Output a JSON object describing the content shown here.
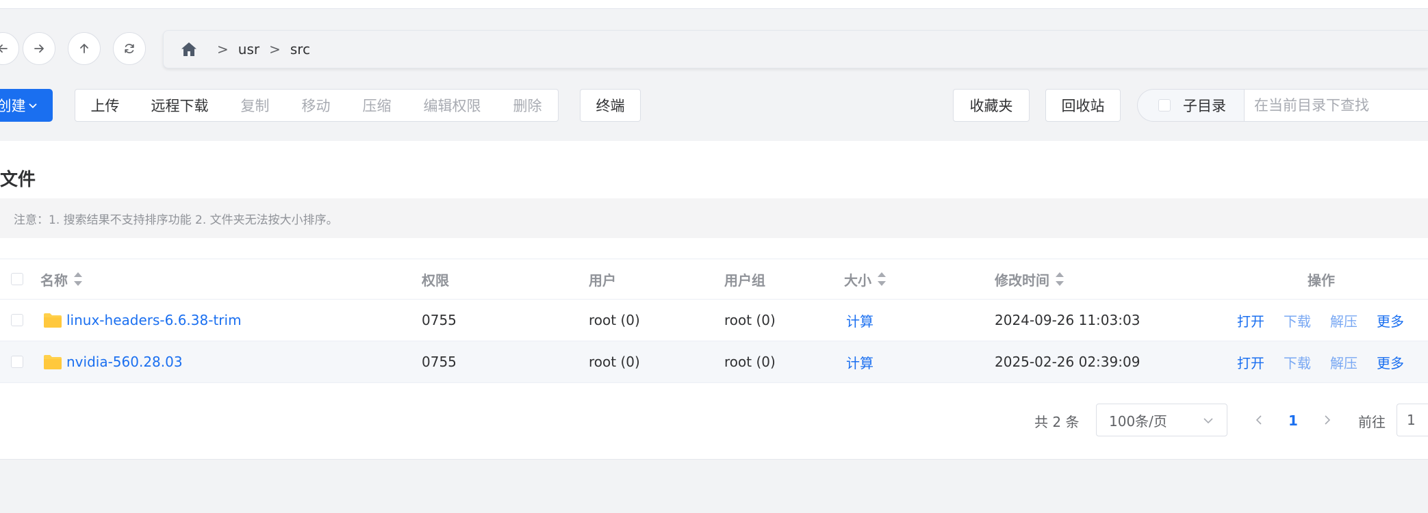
{
  "nav": {
    "back_icon": "arrow-left-icon",
    "forward_icon": "arrow-right-icon",
    "up_icon": "arrow-up-icon",
    "refresh_icon": "refresh-icon"
  },
  "breadcrumb": {
    "home_icon": "home-icon",
    "separator": ">",
    "parts": [
      "usr",
      "src"
    ]
  },
  "toolbar": {
    "new_label": "创建",
    "upload": "上传",
    "remote_download": "远程下载",
    "copy": "复制",
    "move": "移动",
    "compress": "压缩",
    "edit_permissions": "编辑权限",
    "delete": "删除",
    "terminal": "终端",
    "favorites": "收藏夹",
    "recycle_bin": "回收站",
    "subdir_label": "子目录",
    "search_placeholder": "在当前目录下查找"
  },
  "panel": {
    "title": "文件",
    "notice": "注意：1. 搜索结果不支持排序功能 2. 文件夹无法按大小排序。"
  },
  "table": {
    "headers": {
      "name": "名称",
      "permission": "权限",
      "user": "用户",
      "group": "用户组",
      "size": "大小",
      "modified": "修改时间",
      "actions": "操作"
    },
    "rows": [
      {
        "name": "linux-headers-6.6.38-trim",
        "permission": "0755",
        "user": "root (0)",
        "group": "root (0)",
        "size": "计算",
        "modified": "2024-09-26 11:03:03",
        "open": "打开",
        "download": "下载",
        "extract": "解压",
        "more": "更多"
      },
      {
        "name": "nvidia-560.28.03",
        "permission": "0755",
        "user": "root (0)",
        "group": "root (0)",
        "size": "计算",
        "modified": "2025-02-26 02:39:09",
        "open": "打开",
        "download": "下载",
        "extract": "解压",
        "more": "更多"
      }
    ]
  },
  "pagination": {
    "total": "共 2 条",
    "page_size": "100条/页",
    "current_page": "1",
    "goto_label": "前往",
    "goto_value": "1"
  },
  "colors": {
    "accent": "#1a6ff0",
    "folder": "#ffd04b",
    "disabled_text": "#a8abb2"
  }
}
